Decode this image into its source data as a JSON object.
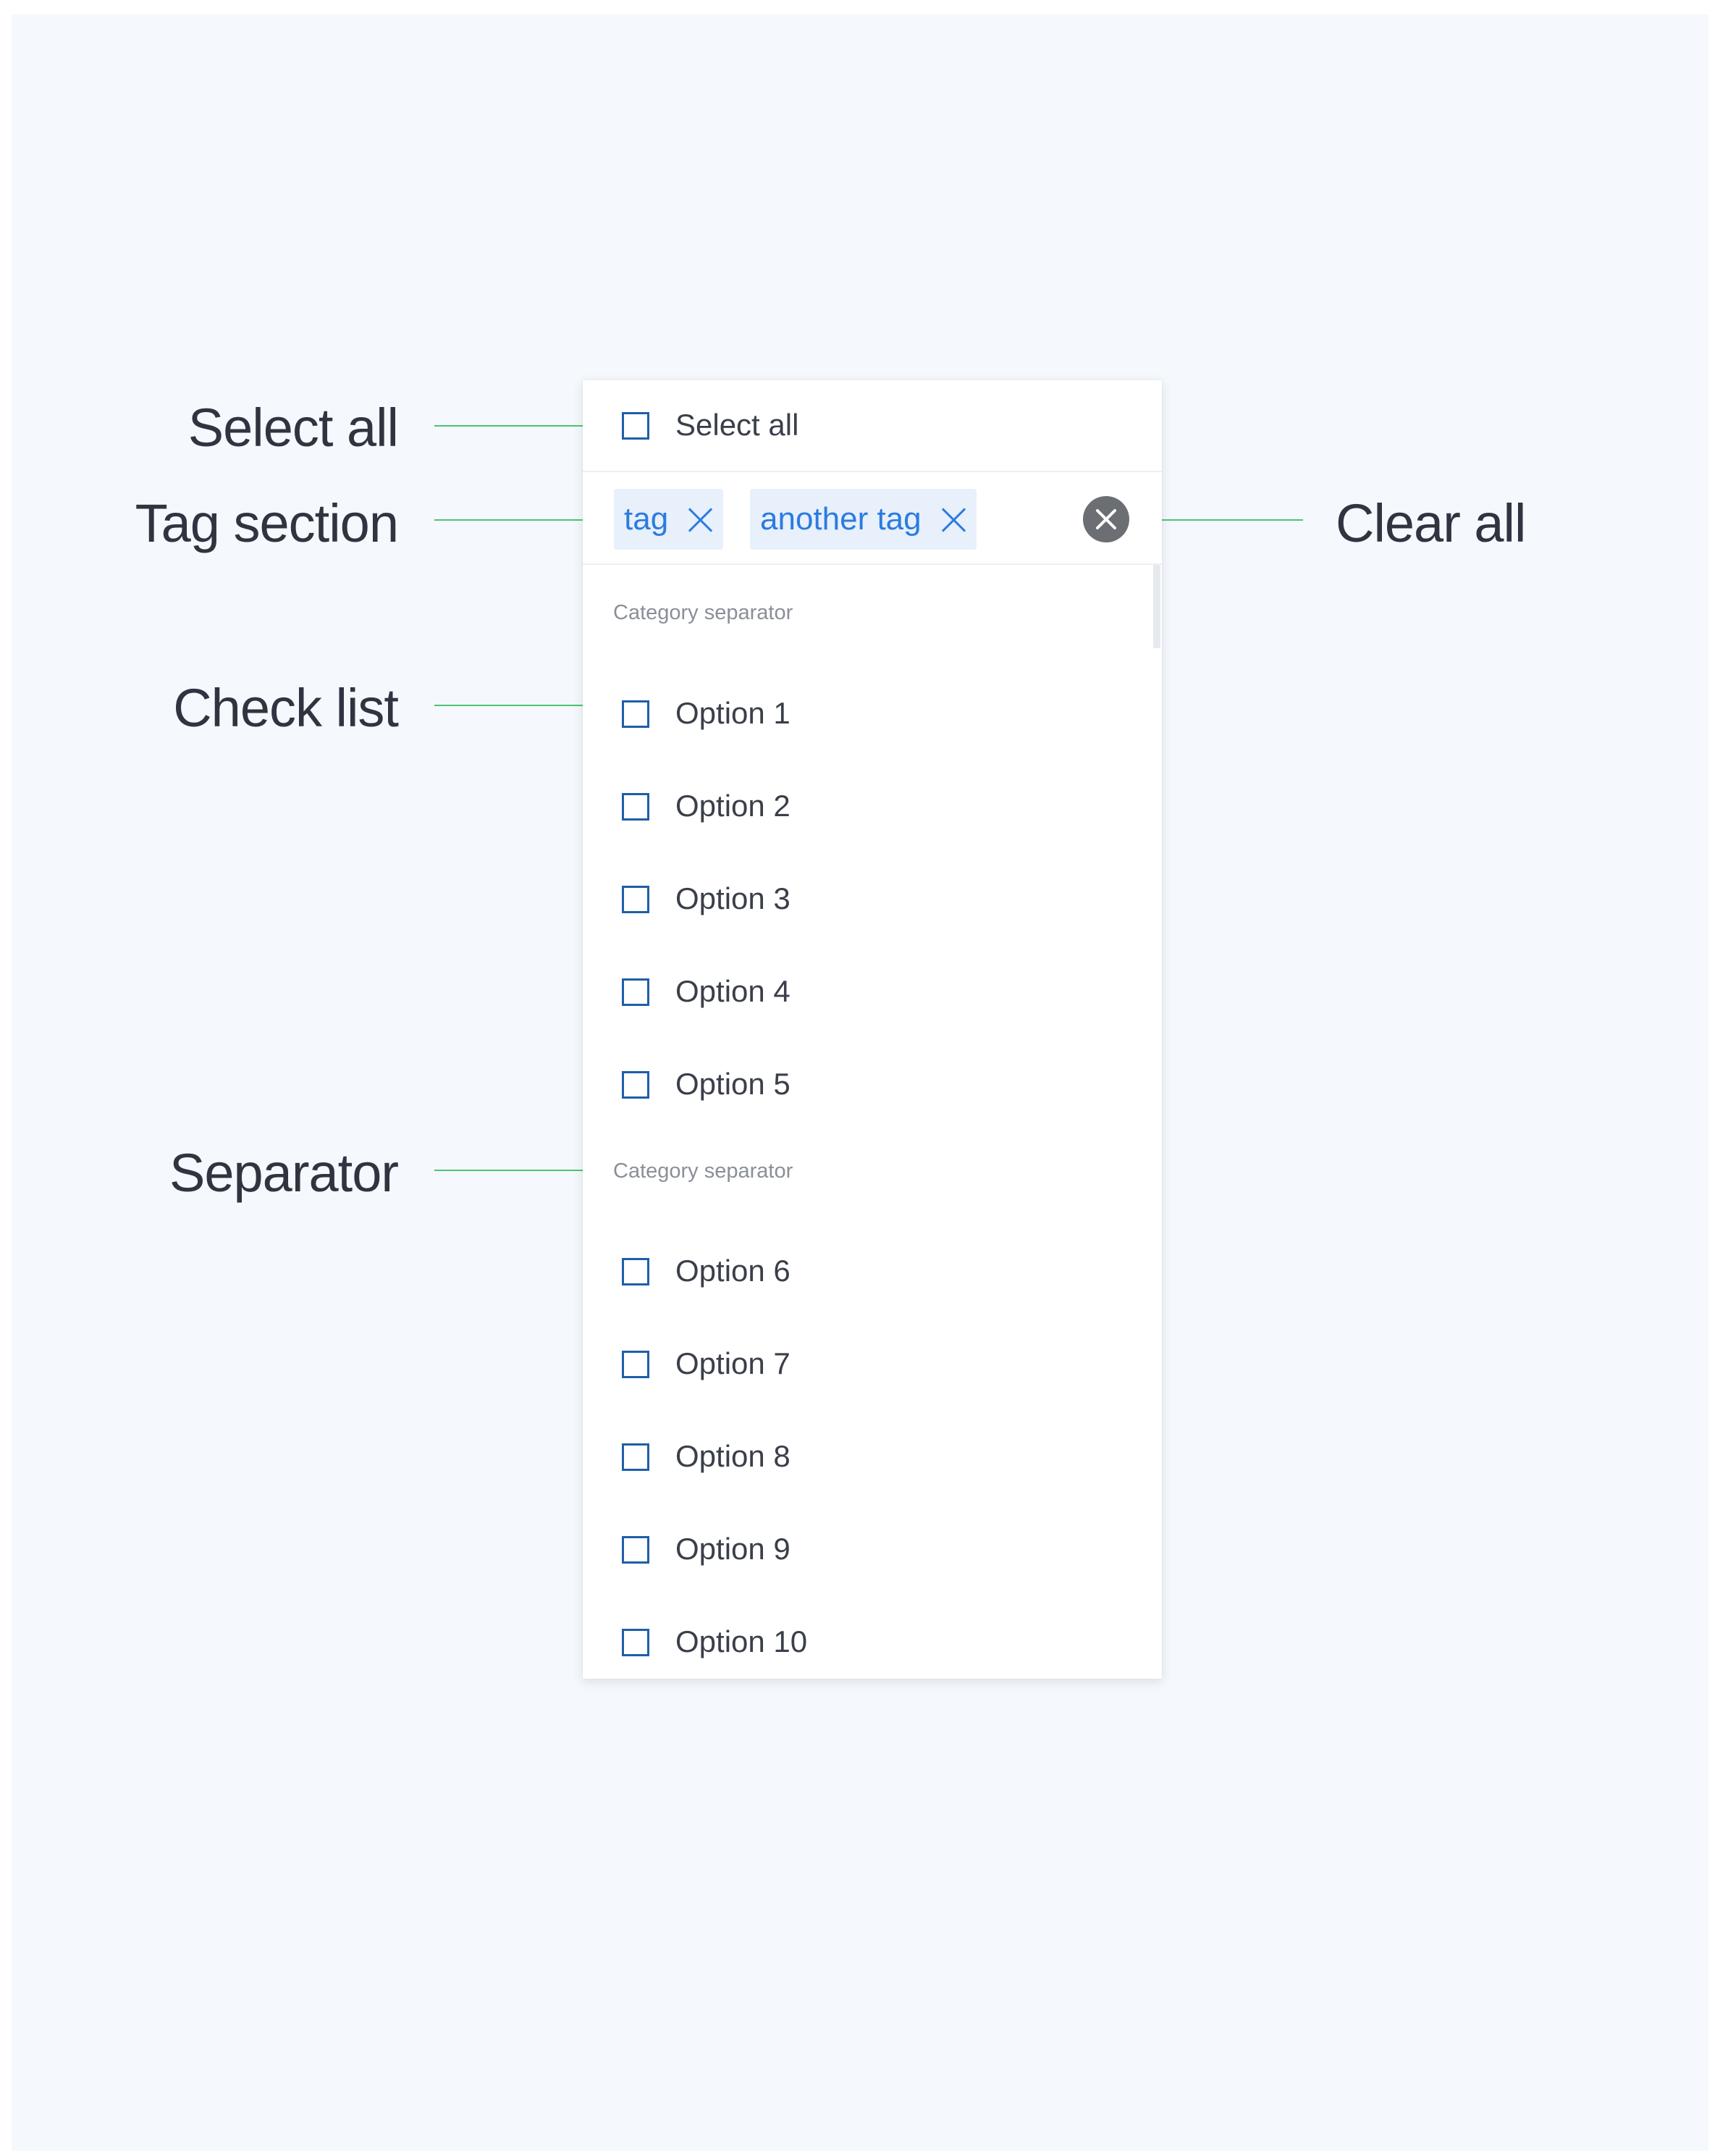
{
  "annotations": {
    "select_all": "Select all",
    "tag_section": "Tag section",
    "check_list": "Check list",
    "separator": "Separator",
    "clear_all": "Clear all"
  },
  "panel": {
    "select_all_label": "Select all",
    "tags": [
      "tag",
      "another tag"
    ],
    "categories": [
      "Category separator",
      "Category separator"
    ],
    "options": [
      "Option 1",
      "Option 2",
      "Option 3",
      "Option 4",
      "Option 5",
      "Option 6",
      "Option 7",
      "Option 8",
      "Option 9",
      "Option 10"
    ]
  },
  "colors": {
    "accent": "#2c7be0",
    "checkbox_border": "#1f5ea8",
    "leader_line": "#4cc472",
    "tag_bg": "#e7f0fb",
    "clear_button": "#6b6e73"
  },
  "icons": {
    "tag_remove": "close-icon",
    "clear_all": "clear-circle-icon"
  }
}
